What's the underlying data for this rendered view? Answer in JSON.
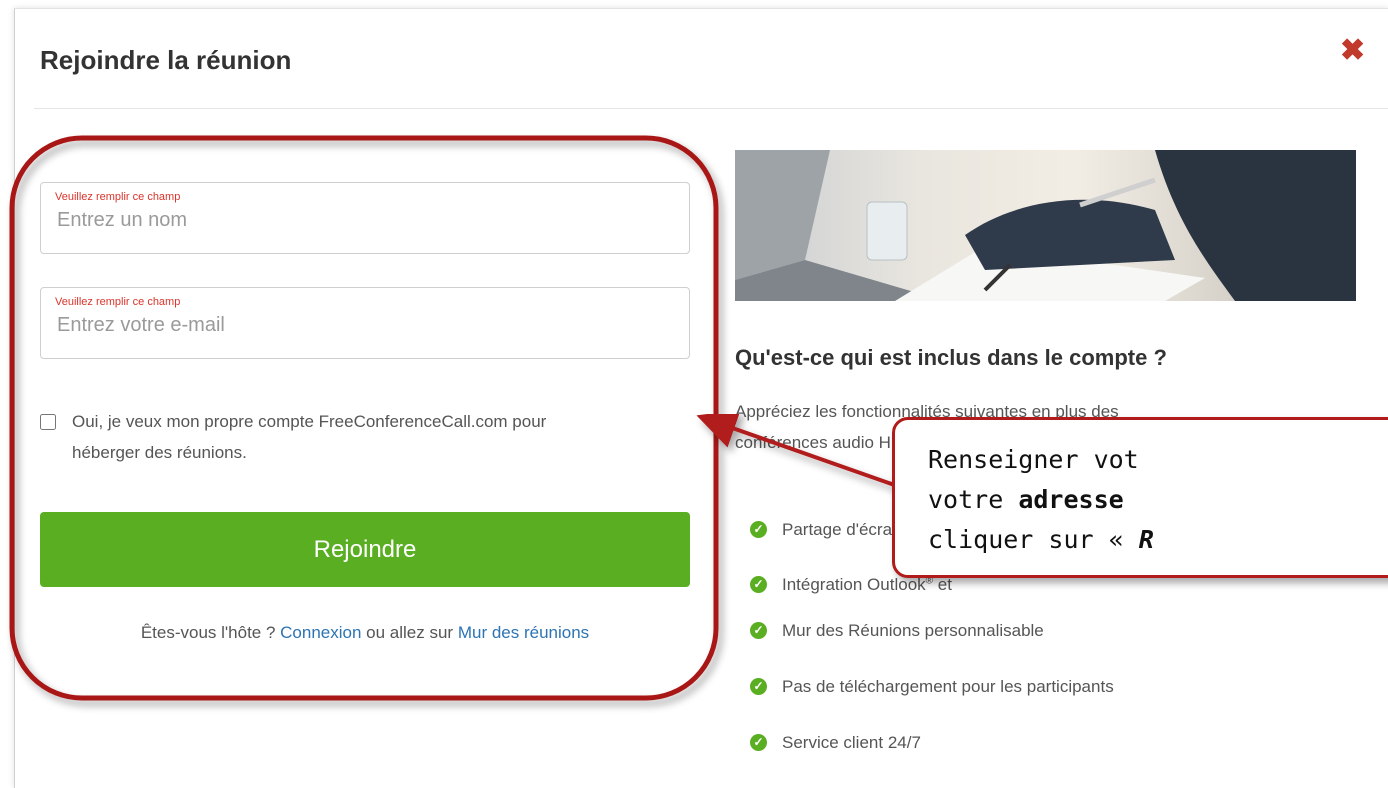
{
  "dialog": {
    "title": "Rejoindre la réunion",
    "close_icon": "close-icon"
  },
  "form": {
    "name": {
      "error": "Veuillez remplir ce champ",
      "placeholder": "Entrez un nom",
      "value": ""
    },
    "email": {
      "error": "Veuillez remplir ce champ",
      "placeholder": "Entrez votre e-mail",
      "value": ""
    },
    "account_checkbox": {
      "line1": "Oui, je veux mon propre compte FreeConferenceCall.com pour",
      "line2": "héberger des réunions.",
      "checked": false
    },
    "submit_label": "Rejoindre",
    "host_prefix": "Êtes-vous l'hôte ? ",
    "login_link": "Connexion",
    "host_middle": " ou allez sur ",
    "meeting_wall_link": "Mur des réunions"
  },
  "included": {
    "title": "Qu'est-ce qui est inclus dans le compte ?",
    "desc_line1": "Appréciez les fonctionnalités suivantes en plus des",
    "desc_line2": "conférences audio HD:",
    "features": [
      "Partage d'écran et enregistrement",
      "Intégration Outlook",
      "Mur des Réunions personnalisable",
      "Pas de téléchargement pour les participants",
      "Service client 24/7"
    ],
    "feature2_sup": "®",
    "feature2_tail": " et",
    "check_icon": "check-circle-icon"
  },
  "callout": {
    "line1": "Renseigner vot",
    "line2_pre": "votre ",
    "line2_bold": "adresse",
    "line3_pre": "cliquer sur « ",
    "line3_bold": "R",
    "accent": "#b11b1b"
  },
  "colors": {
    "primary_button": "#5aae22",
    "link": "#2d74b3",
    "error": "#d9342b",
    "annotation": "#b11b1b"
  }
}
